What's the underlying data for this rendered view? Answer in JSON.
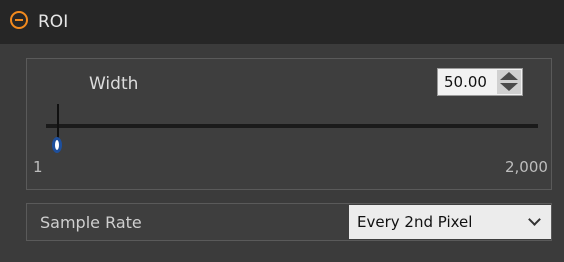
{
  "header": {
    "title": "ROI",
    "icon": "collapse-minus-circle-icon",
    "accent": "#f28a1e"
  },
  "width_control": {
    "label": "Width",
    "value": "50.00",
    "min_label": "1",
    "max_label": "2,000",
    "slider_value": 50
  },
  "sample_rate": {
    "label": "Sample Rate",
    "selected": "Every 2nd Pixel"
  }
}
